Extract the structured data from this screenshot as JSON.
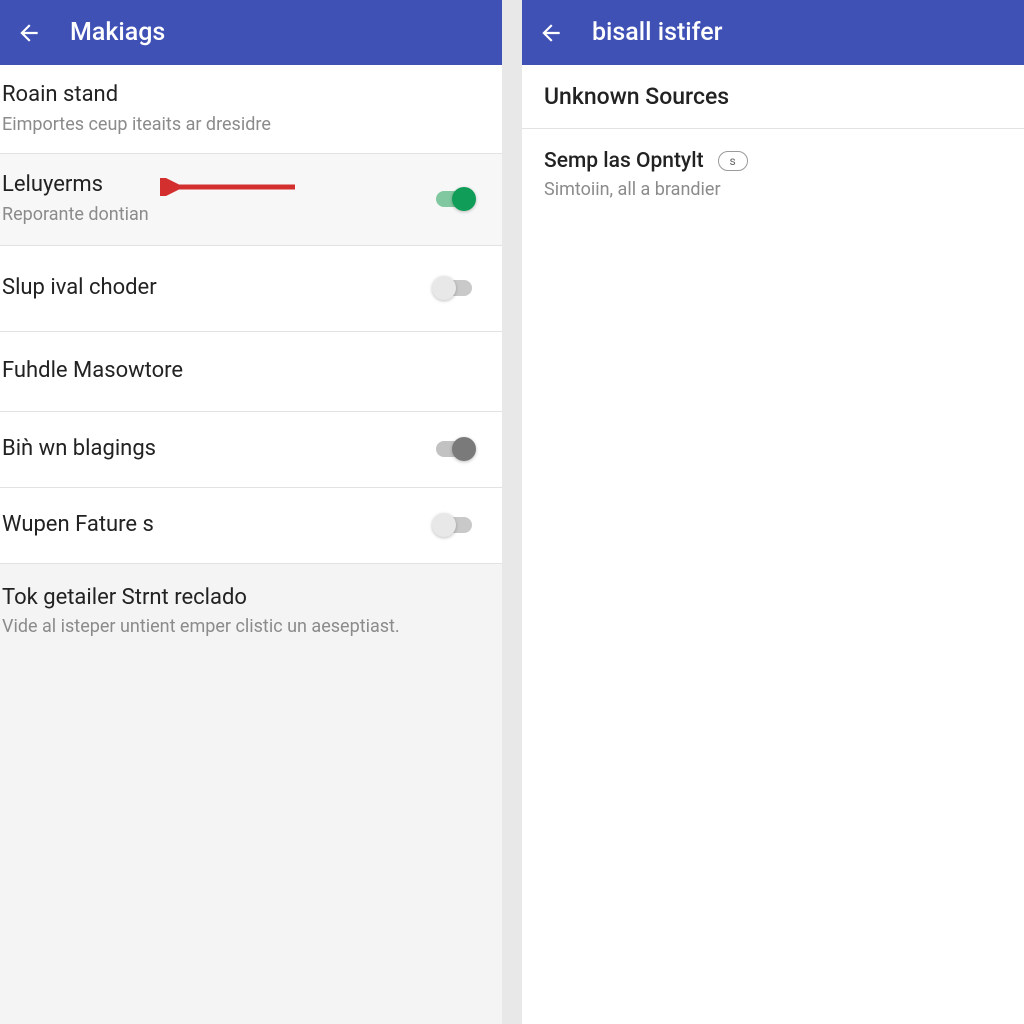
{
  "left": {
    "title": "Makiags",
    "rows": [
      {
        "title": "Roain stand",
        "sub": "Eimportes ceup iteaits ar dresidre"
      },
      {
        "title": "Leluyerms",
        "sub": "Reporante dontian"
      },
      {
        "title": "Slup ival choder",
        "sub": ""
      },
      {
        "title": "Fuhdle Masowtore",
        "sub": ""
      },
      {
        "title": "Biǹ wn blagings",
        "sub": ""
      },
      {
        "title": "Wupen Fature s",
        "sub": ""
      },
      {
        "title": "Tok getailer Strnt reclado",
        "sub": "Vide al isteper untient emper clistic un aeseptiast."
      }
    ]
  },
  "right": {
    "title": "bisall istifer",
    "section_header": "Unknown Sources",
    "row": {
      "title": "Semp las Opntylt",
      "badge": "s",
      "sub": "Simtoiin, all a brandier"
    }
  },
  "colors": {
    "primary": "#3f51b5",
    "toggle_on": "#0f9d58",
    "arrow": "#d32f2f"
  }
}
